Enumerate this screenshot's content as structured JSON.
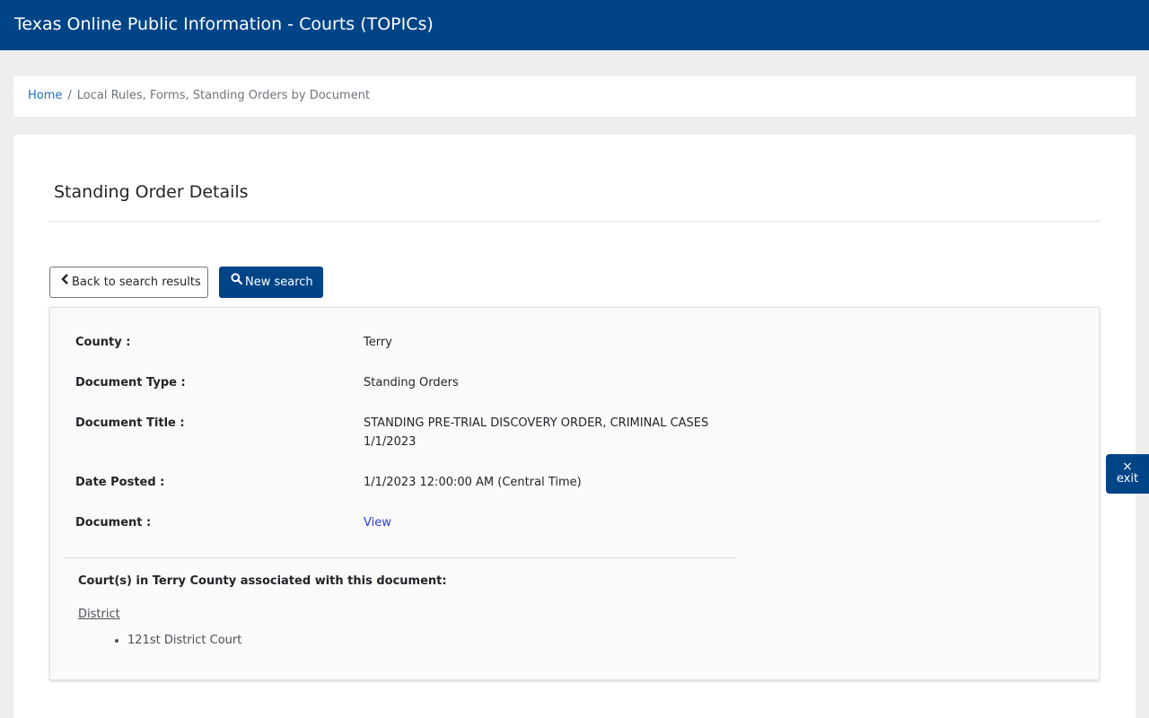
{
  "header": {
    "title": "Texas Online Public Information - Courts (TOPICs)"
  },
  "breadcrumb": {
    "home": "Home",
    "separator": "/",
    "current": "Local Rules, Forms, Standing Orders by Document"
  },
  "page": {
    "title": "Standing Order Details"
  },
  "buttons": {
    "back": "Back to search results",
    "new_search": "New search"
  },
  "details": {
    "county_label": "County :",
    "county_value": "Terry",
    "doctype_label": "Document Type :",
    "doctype_value": "Standing Orders",
    "doctitle_label": "Document Title :",
    "doctitle_value": "STANDING PRE-TRIAL DISCOVERY ORDER, CRIMINAL CASES 1/1/2023",
    "date_label": "Date Posted :",
    "date_value": "1/1/2023 12:00:00 AM (Central Time)",
    "document_label": "Document :",
    "document_link": "View"
  },
  "courts": {
    "heading": "Court(s) in Terry County associated with this document:",
    "type": "District",
    "items": [
      "121st District Court"
    ]
  },
  "exit": {
    "icon": "×",
    "label": "exit"
  },
  "colors": {
    "brand": "#004488",
    "link": "#1e6fb8",
    "view_link": "#2b3fd0"
  }
}
